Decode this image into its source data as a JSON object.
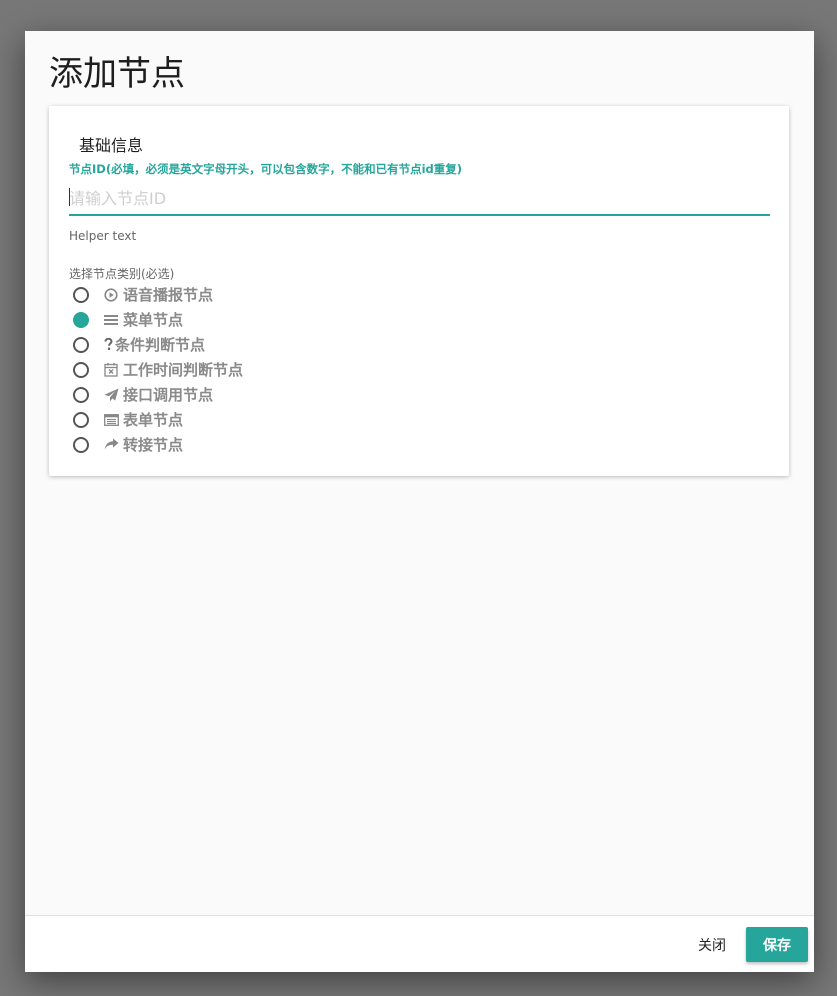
{
  "dialog": {
    "title": "添加节点"
  },
  "section": {
    "title": "基础信息"
  },
  "node_id": {
    "label": "节点ID(必填，必须是英文字母开头，可以包含数字，不能和已有节点id重复)",
    "value": "",
    "placeholder": "请输入节点ID",
    "helper": "Helper text"
  },
  "node_type": {
    "label": "选择节点类别(必选)",
    "options": [
      {
        "label": "语音播报节点",
        "icon": "play-circle-icon",
        "selected": false
      },
      {
        "label": "菜单节点",
        "icon": "menu-list-icon",
        "selected": true
      },
      {
        "label": "条件判断节点",
        "icon": "question-icon",
        "selected": false
      },
      {
        "label": "工作时间判断节点",
        "icon": "calendar-x-icon",
        "selected": false
      },
      {
        "label": "接口调用节点",
        "icon": "paper-plane-icon",
        "selected": false
      },
      {
        "label": "表单节点",
        "icon": "form-icon",
        "selected": false
      },
      {
        "label": "转接节点",
        "icon": "forward-arrow-icon",
        "selected": false
      }
    ]
  },
  "footer": {
    "close_label": "关闭",
    "save_label": "保存"
  },
  "colors": {
    "accent": "#26a69a",
    "muted_text": "#8a8a8a"
  }
}
